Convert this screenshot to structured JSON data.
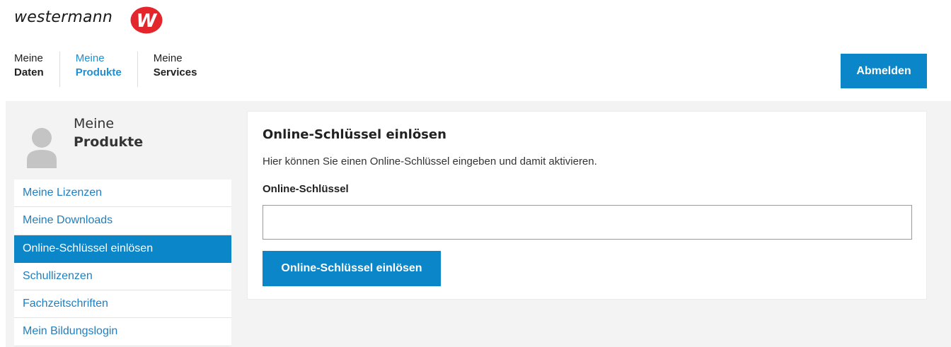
{
  "brand": {
    "name": "westermann",
    "logo_letter": "W",
    "logo_color": "#e3262b"
  },
  "topnav": {
    "items": [
      {
        "top": "Meine",
        "bottom": "Daten"
      },
      {
        "top": "Meine",
        "bottom": "Produkte"
      },
      {
        "top": "Meine",
        "bottom": "Services"
      }
    ],
    "logout_label": "Abmelden"
  },
  "sidebar": {
    "title_line1": "Meine",
    "title_line2": "Produkte",
    "avatar_icon": "user-avatar-icon",
    "items": [
      {
        "label": "Meine Lizenzen"
      },
      {
        "label": "Meine Downloads"
      },
      {
        "label": "Online-Schlüssel einlösen"
      },
      {
        "label": "Schullizenzen"
      },
      {
        "label": "Fachzeitschriften"
      },
      {
        "label": "Mein Bildungslogin"
      }
    ]
  },
  "main": {
    "title": "Online-Schlüssel einlösen",
    "description": "Hier können Sie einen Online-Schlüssel eingeben und damit aktivieren.",
    "field_label": "Online-Schlüssel",
    "field_value": "",
    "submit_label": "Online-Schlüssel einlösen"
  },
  "colors": {
    "accent": "#0a86c9",
    "link": "#1f7fc0",
    "page_bg": "#f3f3f3"
  }
}
